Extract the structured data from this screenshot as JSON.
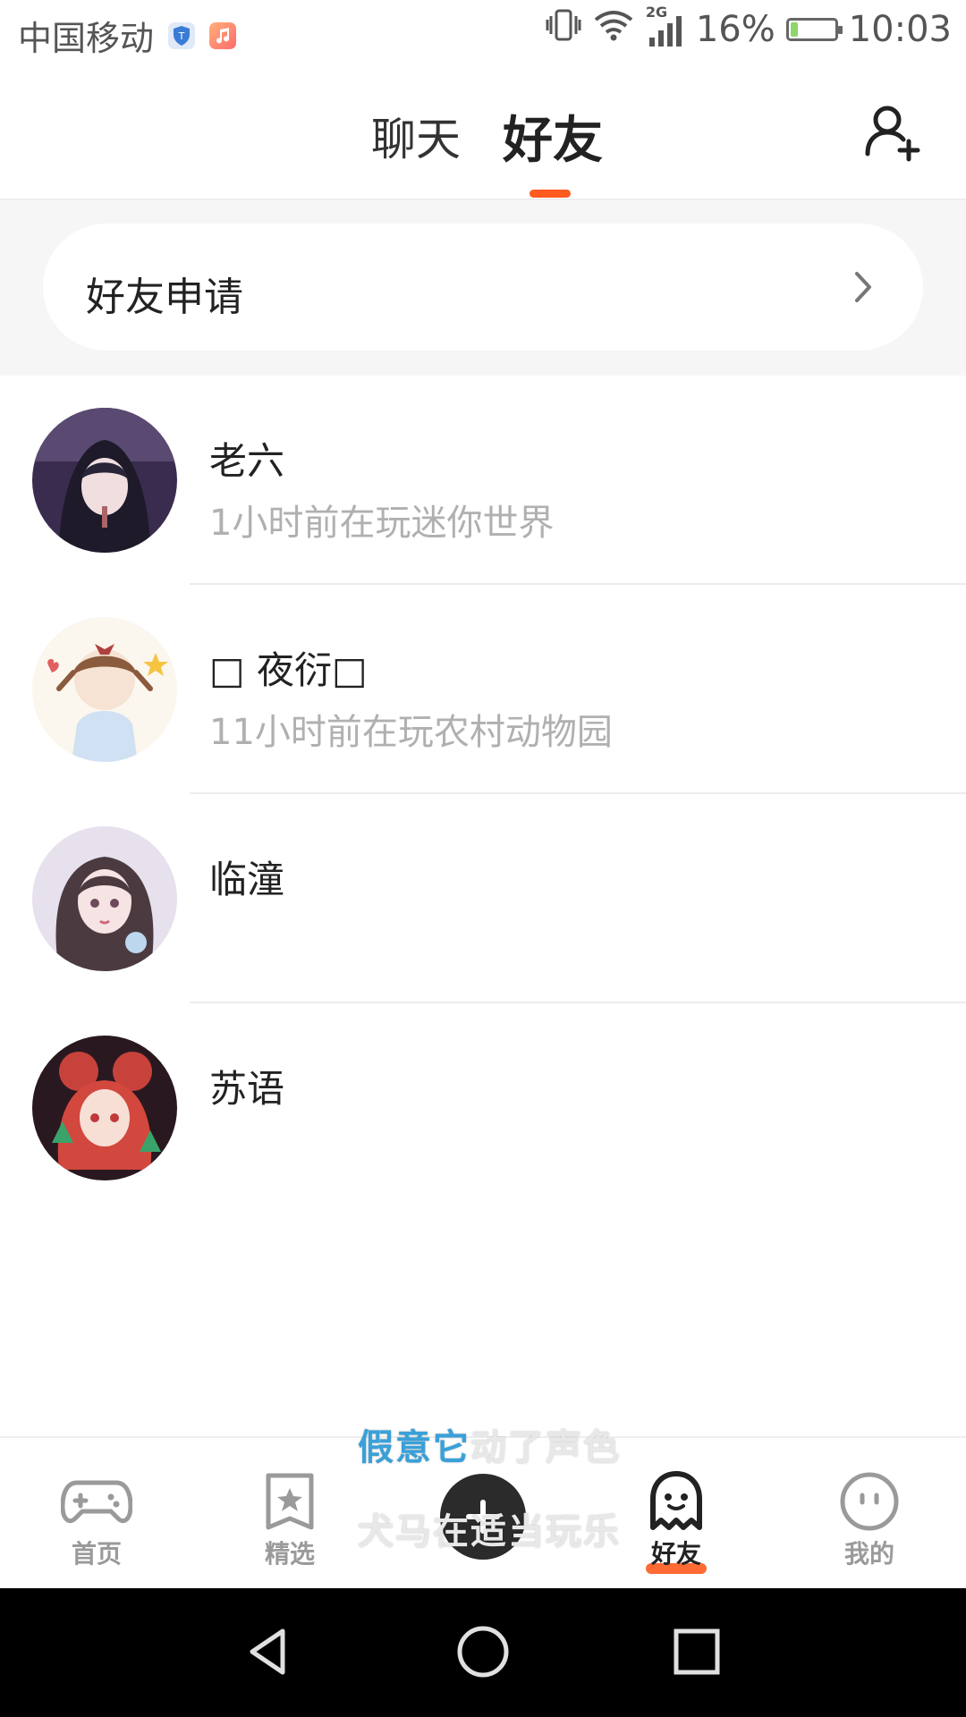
{
  "status_bar": {
    "carrier": "中国移动",
    "network": "2G",
    "battery_percent": "16%",
    "battery_level": 0.16,
    "time": "10:03",
    "icons": [
      "shield-app-icon",
      "music-app-icon",
      "vibrate-icon",
      "wifi-icon",
      "signal-icon",
      "battery-icon"
    ]
  },
  "header": {
    "tabs": [
      {
        "label": "聊天",
        "active": false
      },
      {
        "label": "好友",
        "active": true
      }
    ],
    "accent_color": "#ff5a1f",
    "add_friend_icon": "add-user-icon"
  },
  "friend_request": {
    "label": "好友申请",
    "icon": "chevron-right-icon"
  },
  "friends": [
    {
      "name": "老六",
      "status": "1小时前在玩迷你世界",
      "avatar": "avatar-hooded-boy"
    },
    {
      "name": "□ 夜衍□",
      "status": "11小时前在玩农村动物园",
      "avatar": "avatar-chibi-girl"
    },
    {
      "name": "临潼",
      "status": "",
      "avatar": "avatar-curly-hair-girl"
    },
    {
      "name": "苏语",
      "status": "",
      "avatar": "avatar-red-hair-girl"
    }
  ],
  "lyrics": {
    "line1_highlight": "假意它",
    "line1_rest": "动了声色",
    "line2": "犬马在适当玩乐"
  },
  "bottom_nav": {
    "items": [
      {
        "label": "首页",
        "icon": "gamepad-icon",
        "active": false
      },
      {
        "label": "精选",
        "icon": "star-card-icon",
        "active": false
      },
      {
        "label": "",
        "icon": "plus-icon",
        "active": false
      },
      {
        "label": "好友",
        "icon": "ghost-icon",
        "active": true
      },
      {
        "label": "我的",
        "icon": "face-icon",
        "active": false
      }
    ]
  },
  "system_nav": {
    "icons": [
      "back-icon",
      "home-icon",
      "recents-icon"
    ]
  }
}
